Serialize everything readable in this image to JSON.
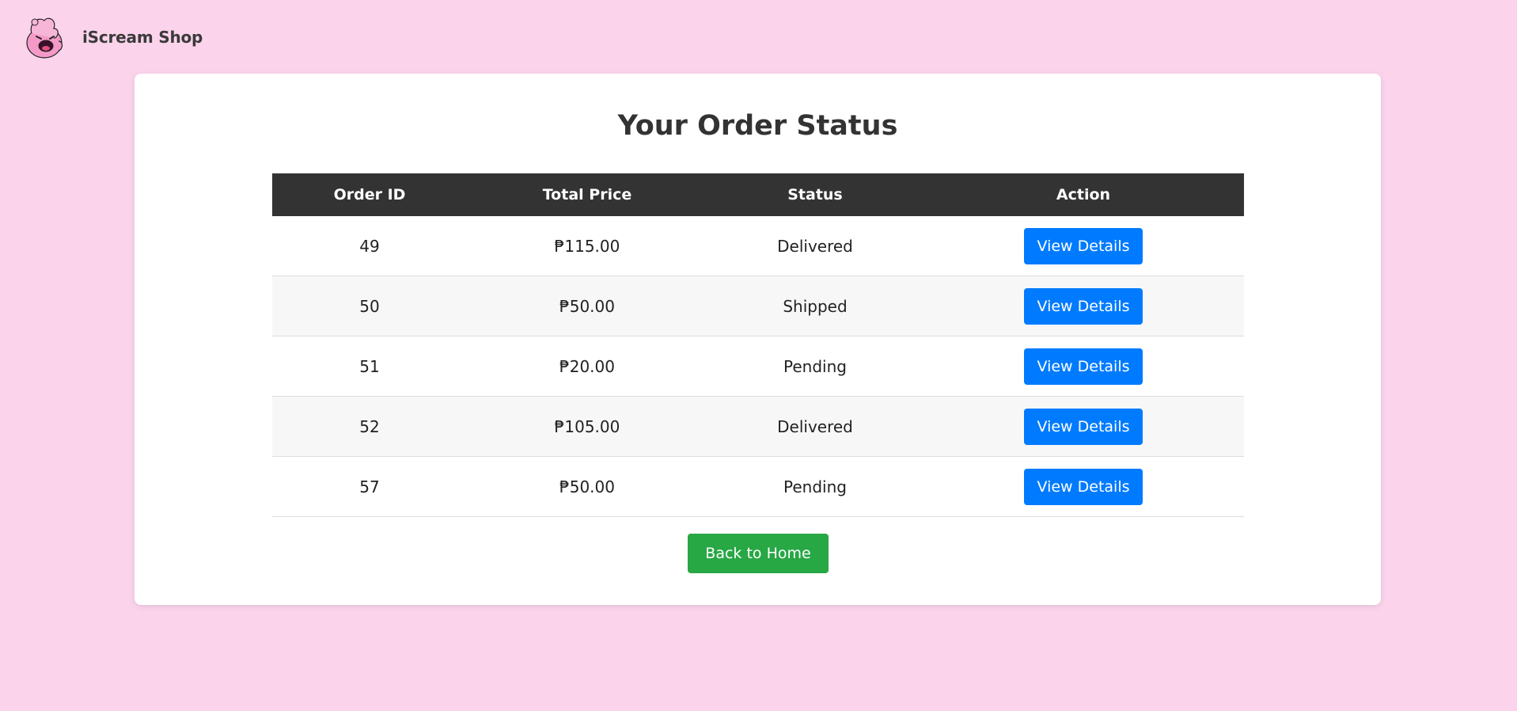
{
  "header": {
    "brand": "iScream Shop"
  },
  "main": {
    "title": "Your Order Status",
    "columns": [
      "Order ID",
      "Total Price",
      "Status",
      "Action"
    ],
    "orders": [
      {
        "id": "49",
        "price": "₱115.00",
        "status": "Delivered",
        "action": "View Details"
      },
      {
        "id": "50",
        "price": "₱50.00",
        "status": "Shipped",
        "action": "View Details"
      },
      {
        "id": "51",
        "price": "₱20.00",
        "status": "Pending",
        "action": "View Details"
      },
      {
        "id": "52",
        "price": "₱105.00",
        "status": "Delivered",
        "action": "View Details"
      },
      {
        "id": "57",
        "price": "₱50.00",
        "status": "Pending",
        "action": "View Details"
      }
    ],
    "back_label": "Back to Home"
  },
  "colors": {
    "background": "#fbd4ec",
    "header_bg": "#333333",
    "primary": "#007bff",
    "success": "#28a745"
  },
  "icons": {
    "logo": "ice-cream-mascot-logo"
  }
}
